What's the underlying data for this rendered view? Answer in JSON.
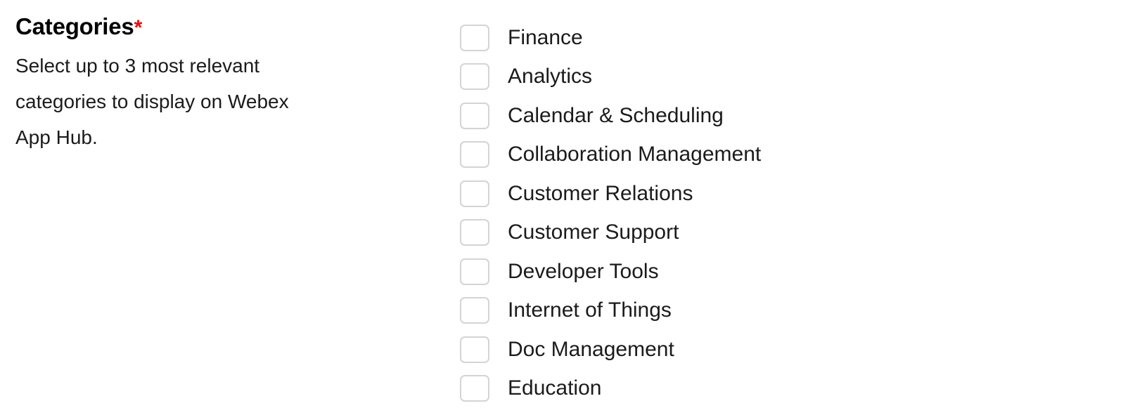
{
  "field": {
    "title": "Categories",
    "required_marker": "*",
    "help_text": "Select up to 3 most relevant categories to display on Webex App Hub."
  },
  "categories": {
    "options": [
      {
        "label": "Finance",
        "checked": false
      },
      {
        "label": "Analytics",
        "checked": false
      },
      {
        "label": "Calendar & Scheduling",
        "checked": false
      },
      {
        "label": "Collaboration Management",
        "checked": false
      },
      {
        "label": "Customer Relations",
        "checked": false
      },
      {
        "label": "Customer Support",
        "checked": false
      },
      {
        "label": "Developer Tools",
        "checked": false
      },
      {
        "label": "Internet of Things",
        "checked": false
      },
      {
        "label": "Doc Management",
        "checked": false
      },
      {
        "label": "Education",
        "checked": false
      }
    ]
  },
  "colors": {
    "required_asterisk": "#ff0000",
    "text": "#1b1b1b",
    "title": "#000000",
    "checkbox_border": "#d4d4d6",
    "background": "#ffffff"
  }
}
